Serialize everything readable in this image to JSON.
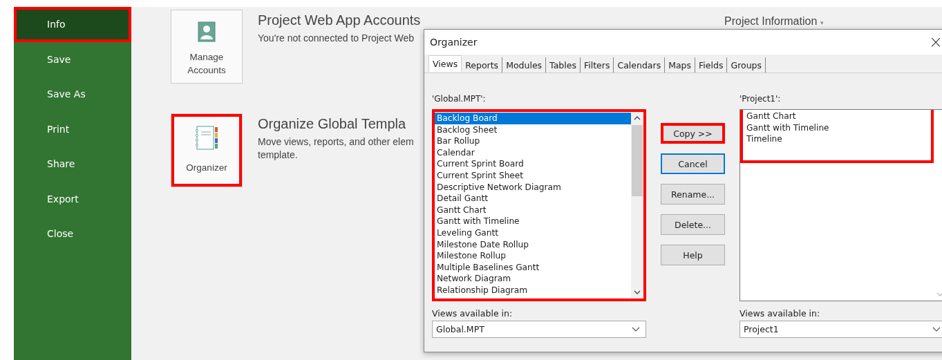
{
  "sidebar": {
    "items": [
      {
        "label": "Info",
        "selected": true,
        "highlighted": true
      },
      {
        "label": "Save",
        "selected": false,
        "highlighted": false
      },
      {
        "label": "Save As",
        "selected": false,
        "highlighted": false
      },
      {
        "label": "Print",
        "selected": false,
        "highlighted": false
      },
      {
        "label": "Share",
        "selected": false,
        "highlighted": false
      },
      {
        "label": "Export",
        "selected": false,
        "highlighted": false
      },
      {
        "label": "Close",
        "selected": false,
        "highlighted": false
      }
    ]
  },
  "project_info": {
    "label": "Project Information",
    "caret": "▾"
  },
  "sections": [
    {
      "kind": "accounts",
      "button": "Manage Accounts",
      "highlighted": false,
      "title": "Project Web App Accounts",
      "lines": [
        "You're not connected to Project Web"
      ]
    },
    {
      "kind": "organizer",
      "button": "Organizer",
      "highlighted": true,
      "title": "Organize Global Templa",
      "lines": [
        "Move views, reports, and other elem",
        "template."
      ]
    }
  ],
  "dialog": {
    "title": "Organizer",
    "close": "×",
    "tabs": [
      {
        "label": "Views",
        "selected": true
      },
      {
        "label": "Reports",
        "selected": false
      },
      {
        "label": "Modules",
        "selected": false
      },
      {
        "label": "Tables",
        "selected": false
      },
      {
        "label": "Filters",
        "selected": false
      },
      {
        "label": "Calendars",
        "selected": false
      },
      {
        "label": "Maps",
        "selected": false
      },
      {
        "label": "Fields",
        "selected": false
      },
      {
        "label": "Groups",
        "selected": false
      }
    ],
    "left": {
      "label": "'Global.MPT':",
      "highlighted": true,
      "items": [
        {
          "label": "Backlog Board",
          "selected": true
        },
        {
          "label": "Backlog Sheet",
          "selected": false
        },
        {
          "label": "Bar Rollup",
          "selected": false
        },
        {
          "label": "Calendar",
          "selected": false
        },
        {
          "label": "Current Sprint Board",
          "selected": false
        },
        {
          "label": "Current Sprint Sheet",
          "selected": false
        },
        {
          "label": "Descriptive Network Diagram",
          "selected": false
        },
        {
          "label": "Detail Gantt",
          "selected": false
        },
        {
          "label": "Gantt Chart",
          "selected": false
        },
        {
          "label": "Gantt with Timeline",
          "selected": false
        },
        {
          "label": "Leveling Gantt",
          "selected": false
        },
        {
          "label": "Milestone Date Rollup",
          "selected": false
        },
        {
          "label": "Milestone Rollup",
          "selected": false
        },
        {
          "label": "Multiple Baselines Gantt",
          "selected": false
        },
        {
          "label": "Network Diagram",
          "selected": false
        },
        {
          "label": "Relationship Diagram",
          "selected": false
        }
      ],
      "available_label": "Views available in:",
      "available_value": "Global.MPT"
    },
    "right": {
      "label": "'Project1':",
      "highlighted": true,
      "items": [
        {
          "label": "Gantt Chart",
          "selected": false
        },
        {
          "label": "Gantt with Timeline",
          "selected": false
        },
        {
          "label": "Timeline",
          "selected": false
        }
      ],
      "available_label": "Views available in:",
      "available_value": "Project1"
    },
    "buttons": [
      {
        "label": "Copy >>",
        "highlighted": true,
        "default": false
      },
      {
        "label": "Cancel",
        "highlighted": false,
        "default": true
      },
      {
        "label": "Rename...",
        "highlighted": false,
        "default": false
      },
      {
        "label": "Delete...",
        "highlighted": false,
        "default": false
      },
      {
        "label": "Help",
        "highlighted": false,
        "default": false
      }
    ]
  }
}
